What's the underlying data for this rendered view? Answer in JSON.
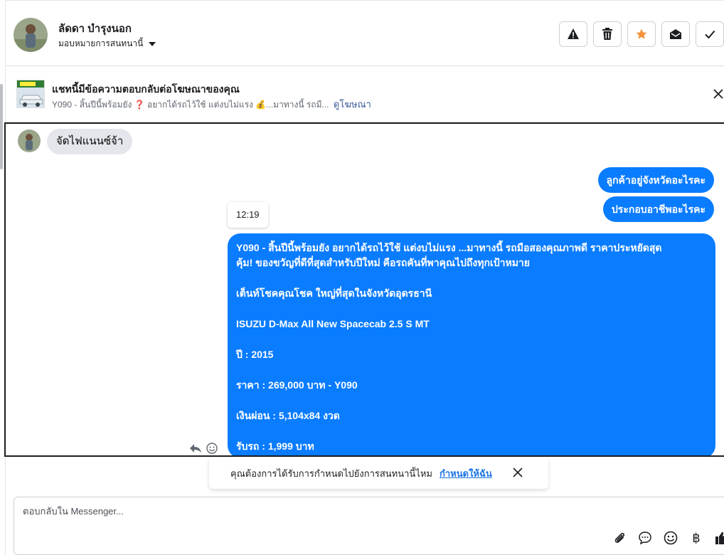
{
  "header": {
    "contact_name": "ลัดดา บำรุงนอก",
    "assign_label": "มอบหมายการสนทนานี้",
    "actions": [
      "mark-spam",
      "delete",
      "star",
      "mark-unread",
      "mark-done"
    ]
  },
  "ad": {
    "title": "แชทนี้มีข้อความตอบกลับต่อโฆษณาของคุณ",
    "snippet": "Y090 - สิ้นปีนี้พร้อมยัง ❓ อยากได้รถไว้ใช้ แต่งบไม่แรง 💰...มาทางนี้ รถมื...",
    "link": "ดูโฆษณา"
  },
  "chat": {
    "incoming_text": "จัดไฟแนนซ์จ้า",
    "outgoing_1": "ลูกค้าอยู่จังหวัดอะไรคะ",
    "outgoing_2": "ประกอบอาชีพอะไรคะ",
    "time": "12:19",
    "ad_message": {
      "line1": "Y090 - สิ้นปีนี้พร้อมยัง อยากได้รถไว้ใช้ แต่งบไม่แรง ...มาทางนี้ รถมือสองคุณภาพดี ราคาประหยัดสุด",
      "line2": "คุ้ม! ของขวัญที่ดีที่สุดสำหรับปีใหม่ คือรถคันที่พาคุณไปถึงทุกเป้าหมาย",
      "line3": " เต็นท์โชคคุณโชค ใหญ่ที่สุดในจังหวัดอุดรธานี",
      "line4": "ISUZU D-Max All New Spacecab 2.5 S MT",
      "line5": "ปี : 2015",
      "line6": "ราคา : 269,000 บาท - Y090",
      "line7": "เงินผ่อน : 5,104x84 งวด",
      "line8": "รับรถ : 1,999 บาท"
    }
  },
  "suggestion": {
    "text": "คุณต้องการได้รับการกำหนดไปยังการสนทนานี้ไหม",
    "link": "กำหนดให้ฉัน"
  },
  "composer": {
    "placeholder": "ตอบกลับใน Messenger...",
    "baht_symbol": "฿"
  },
  "colors": {
    "accent_blue": "#0a7cff",
    "incoming_gray": "#e4e6eb",
    "star_orange": "#f7923b"
  }
}
